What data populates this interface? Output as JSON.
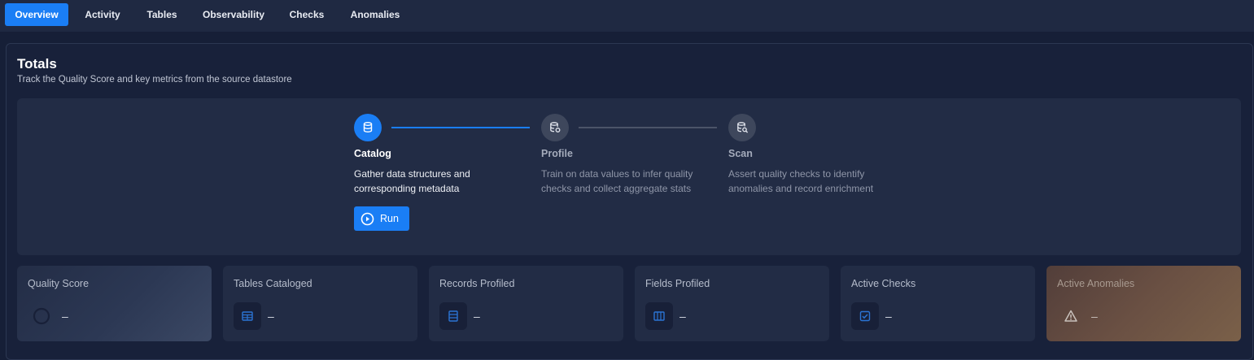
{
  "tabs": [
    {
      "label": "Overview",
      "active": true
    },
    {
      "label": "Activity",
      "active": false
    },
    {
      "label": "Tables",
      "active": false
    },
    {
      "label": "Observability",
      "active": false
    },
    {
      "label": "Checks",
      "active": false
    },
    {
      "label": "Anomalies",
      "active": false
    }
  ],
  "totals": {
    "title": "Totals",
    "subtitle": "Track the Quality Score and key metrics from the source datastore"
  },
  "steps": [
    {
      "title": "Catalog",
      "description": "Gather data structures and corresponding metadata",
      "active": true,
      "icon": "database-icon"
    },
    {
      "title": "Profile",
      "description": "Train on data values to infer quality checks and collect aggregate stats",
      "active": false,
      "icon": "database-settings-icon"
    },
    {
      "title": "Scan",
      "description": "Assert quality checks to identify anomalies and record enrichment",
      "active": false,
      "icon": "database-search-icon"
    }
  ],
  "run_button": {
    "label": "Run",
    "icon": "play-circle-icon"
  },
  "metrics": [
    {
      "label": "Quality Score",
      "value": "–",
      "icon": "score-ring-icon"
    },
    {
      "label": "Tables Cataloged",
      "value": "–",
      "icon": "table-icon"
    },
    {
      "label": "Records Profiled",
      "value": "–",
      "icon": "rows-icon"
    },
    {
      "label": "Fields Profiled",
      "value": "–",
      "icon": "columns-icon"
    },
    {
      "label": "Active Checks",
      "value": "–",
      "icon": "check-square-icon"
    },
    {
      "label": "Active Anomalies",
      "value": "–",
      "icon": "warning-icon"
    }
  ],
  "colors": {
    "accent": "#1a7ef5",
    "background": "#161f37",
    "card": "#222c45",
    "anomaly_card_gradient_end": "#7a6049"
  }
}
